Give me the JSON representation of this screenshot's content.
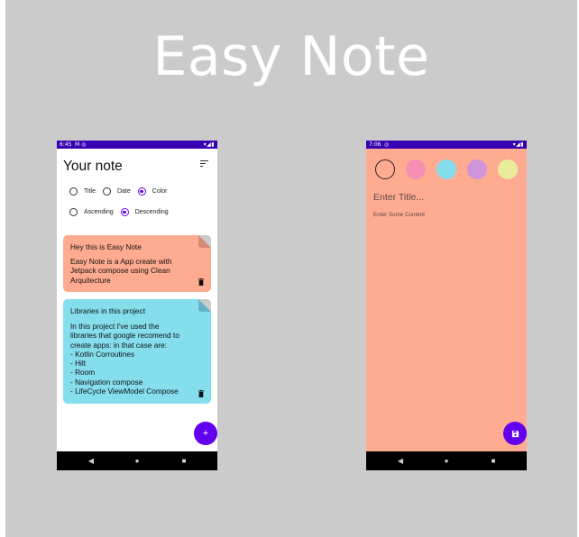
{
  "hero": {
    "title": "Easy Note"
  },
  "left_phone": {
    "status": {
      "time": "6:45",
      "icons_left": "M ◎",
      "icons_right": "▾◢▮"
    },
    "header": {
      "title": "Your note"
    },
    "order_options": [
      {
        "label": "Title",
        "selected": false
      },
      {
        "label": "Date",
        "selected": false
      },
      {
        "label": "Color",
        "selected": true
      }
    ],
    "direction_options": [
      {
        "label": "Ascending",
        "selected": false
      },
      {
        "label": "Descending",
        "selected": true
      }
    ],
    "notes": [
      {
        "title": "Hey this is Easy Note",
        "body": "Easy Note is a App create with\nJetpack compose using Clean\nArquitecture",
        "color": "#ffab91"
      },
      {
        "title": "Libraries in this project",
        "body": "In this project I've used the\nlibraries that google recomend to\ncreate apps: in that case are:\n- Kotlin Corroutines\n- Hilt\n- Room\n- Navigation compose\n- LifeCycle ViewModel Compose",
        "color": "#84deec"
      }
    ],
    "fab": {
      "icon": "add-icon",
      "glyph": "+"
    },
    "nav": {
      "back": "◀",
      "home": "●",
      "recent": "■"
    }
  },
  "right_phone": {
    "status": {
      "time": "7:06",
      "icons_left": "◎",
      "icons_right": "▾◢▮"
    },
    "colors": [
      {
        "hex": "#ffab91",
        "selected": true
      },
      {
        "hex": "#f48fb1",
        "selected": false
      },
      {
        "hex": "#84deec",
        "selected": false
      },
      {
        "hex": "#cf94da",
        "selected": false
      },
      {
        "hex": "#e7ed9b",
        "selected": false
      }
    ],
    "title_placeholder": "Enter Title...",
    "content_placeholder": "Enter Some Content",
    "fab": {
      "icon": "save-icon"
    },
    "nav": {
      "back": "◀",
      "home": "●",
      "recent": "■"
    }
  },
  "colors": {
    "primary": "#6200ee",
    "status_bar": "#3700b3",
    "background": "#cbcbcb"
  }
}
